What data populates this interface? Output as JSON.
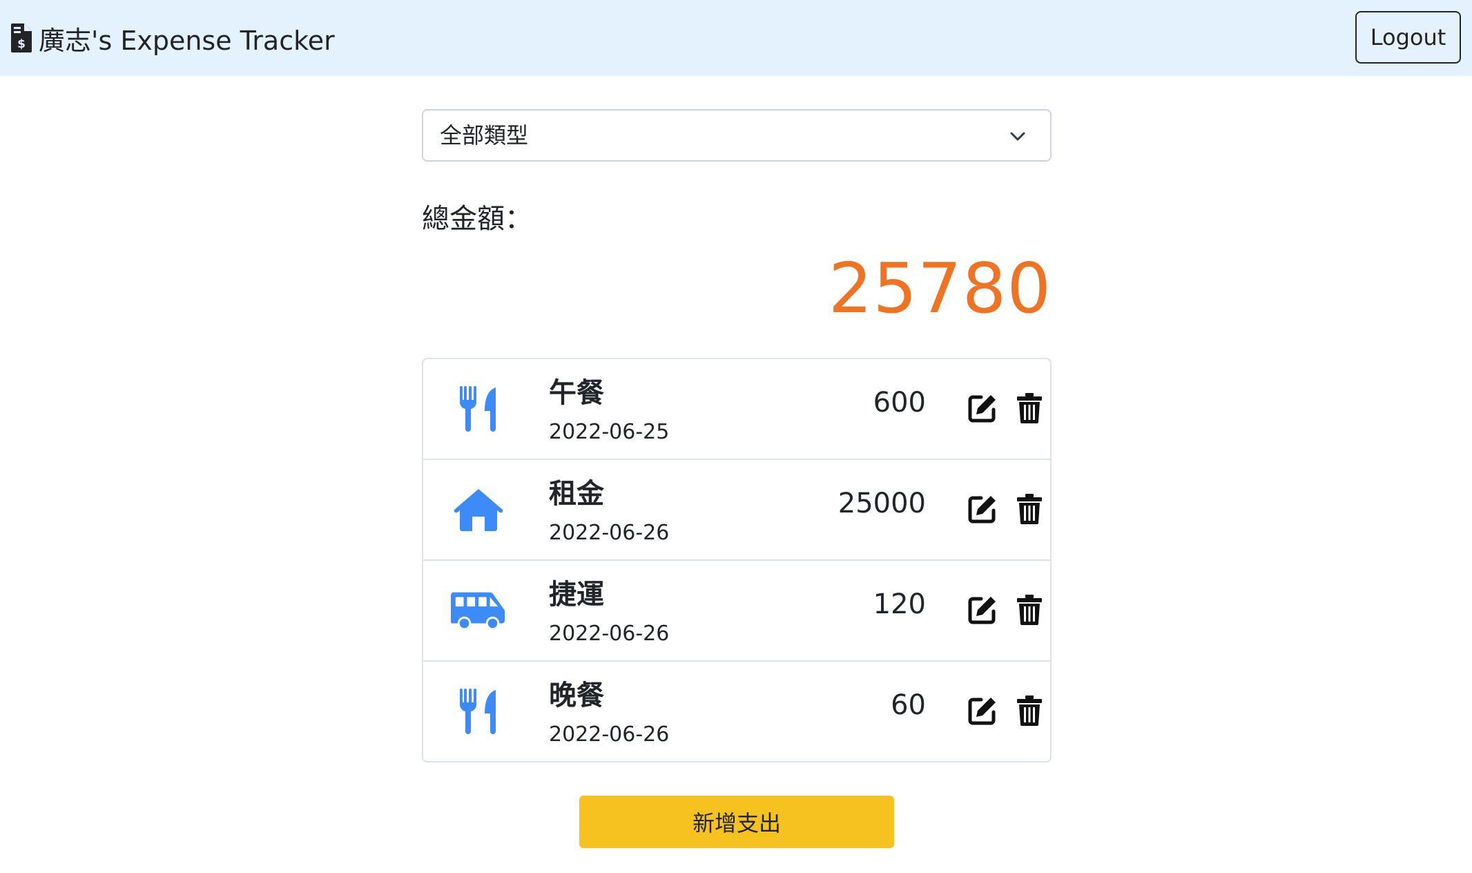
{
  "navbar": {
    "brand_text": "廣志's Expense Tracker",
    "brand_icon": "file-invoice-dollar-icon",
    "logout_label": "Logout",
    "background_color": "#e3f2fd"
  },
  "filter": {
    "selected": "全部類型",
    "icon": "chevron-down-icon"
  },
  "total": {
    "label": "總金額：",
    "amount": "25780",
    "color": "#ee7322"
  },
  "records": [
    {
      "name": "午餐",
      "date": "2022-06-25",
      "amount": "600",
      "category_icon": "utensils-icon"
    },
    {
      "name": "租金",
      "date": "2022-06-26",
      "amount": "25000",
      "category_icon": "home-icon"
    },
    {
      "name": "捷運",
      "date": "2022-06-26",
      "amount": "120",
      "category_icon": "shuttle-van-icon"
    },
    {
      "name": "晚餐",
      "date": "2022-06-26",
      "amount": "60",
      "category_icon": "utensils-icon"
    }
  ],
  "actions": {
    "edit_icon": "edit-icon",
    "delete_icon": "trash-icon"
  },
  "add_button": {
    "label": "新增支出",
    "color": "#f6c21f"
  },
  "icon_color": "#3d8bf8"
}
